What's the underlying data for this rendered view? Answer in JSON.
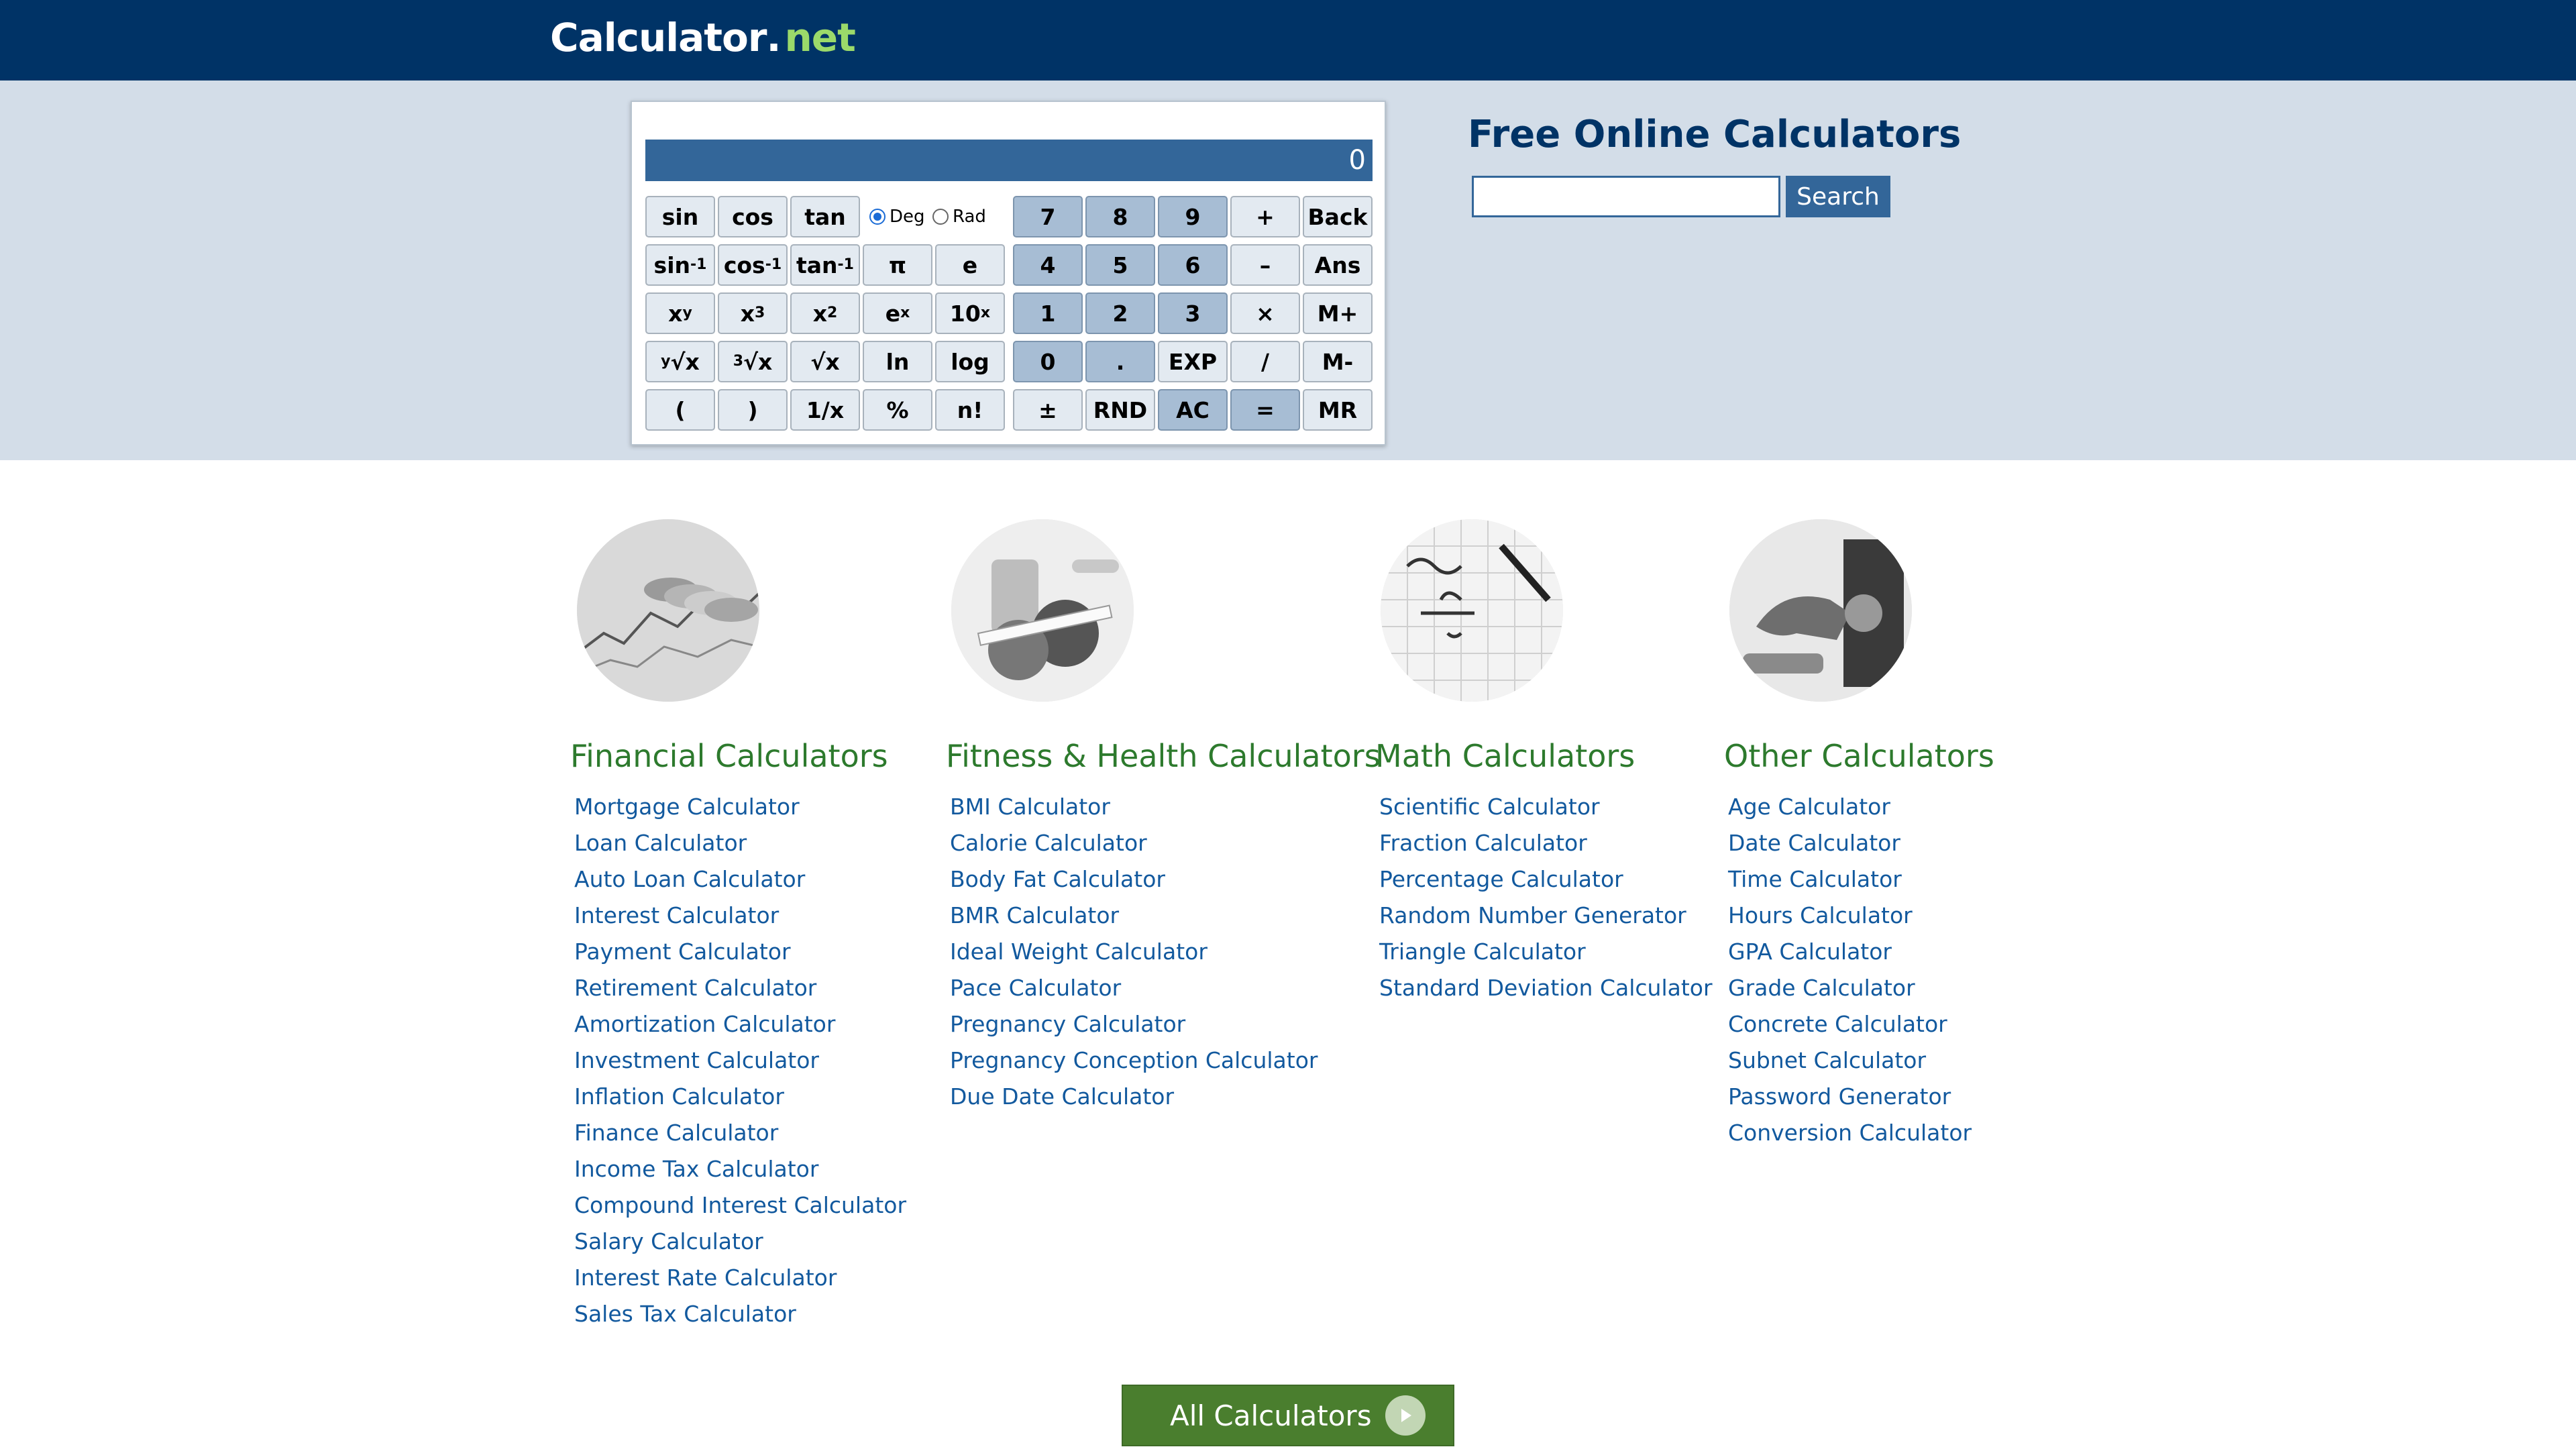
{
  "header": {
    "logo_part1": "Calculator",
    "logo_part2": ".",
    "logo_part3": "net"
  },
  "calculator": {
    "display_value": "0",
    "angle_mode": {
      "deg_label": "Deg",
      "rad_label": "Rad",
      "selected": "Deg"
    },
    "keys": {
      "sin": "sin",
      "cos": "cos",
      "tan": "tan",
      "asin": "sin",
      "acos": "cos",
      "atan": "tan",
      "inv": "-1",
      "pi": "π",
      "e": "e",
      "xy_base": "x",
      "xy_exp": "y",
      "x3_base": "x",
      "x3_exp": "3",
      "x2_base": "x",
      "x2_exp": "2",
      "ex_base": "e",
      "ex_exp": "x",
      "tenx_base": "10",
      "tenx_exp": "x",
      "yroot_pre": "y",
      "yroot": "√x",
      "croot_pre": "3",
      "croot": "√x",
      "sqrt": "√x",
      "ln": "ln",
      "log": "log",
      "lparen": "(",
      "rparen": ")",
      "recip": "1/x",
      "percent": "%",
      "fact": "n!",
      "n7": "7",
      "n8": "8",
      "n9": "9",
      "n4": "4",
      "n5": "5",
      "n6": "6",
      "n1": "1",
      "n2": "2",
      "n3": "3",
      "n0": "0",
      "dot": ".",
      "plus": "+",
      "minus": "–",
      "times": "×",
      "divide": "/",
      "back": "Back",
      "ans": "Ans",
      "mplus": "M+",
      "mminus": "M-",
      "mr": "MR",
      "exp": "EXP",
      "plusminus": "±",
      "rnd": "RND",
      "ac": "AC",
      "equals": "="
    }
  },
  "search": {
    "title": "Free Online Calculators",
    "button_label": "Search",
    "value": ""
  },
  "categories": [
    {
      "title": "Financial Calculators",
      "items": [
        "Mortgage Calculator",
        "Loan Calculator",
        "Auto Loan Calculator",
        "Interest Calculator",
        "Payment Calculator",
        "Retirement Calculator",
        "Amortization Calculator",
        "Investment Calculator",
        "Inflation Calculator",
        "Finance Calculator",
        "Income Tax Calculator",
        "Compound Interest Calculator",
        "Salary Calculator",
        "Interest Rate Calculator",
        "Sales Tax Calculator"
      ]
    },
    {
      "title": "Fitness & Health Calculators",
      "items": [
        "BMI Calculator",
        "Calorie Calculator",
        "Body Fat Calculator",
        "BMR Calculator",
        "Ideal Weight Calculator",
        "Pace Calculator",
        "Pregnancy Calculator",
        "Pregnancy Conception Calculator",
        "Due Date Calculator"
      ]
    },
    {
      "title": "Math Calculators",
      "items": [
        "Scientific Calculator",
        "Fraction Calculator",
        "Percentage Calculator",
        "Random Number Generator",
        "Triangle Calculator",
        "Standard Deviation Calculator"
      ]
    },
    {
      "title": "Other Calculators",
      "items": [
        "Age Calculator",
        "Date Calculator",
        "Time Calculator",
        "Hours Calculator",
        "GPA Calculator",
        "Grade Calculator",
        "Concrete Calculator",
        "Subnet Calculator",
        "Password Generator",
        "Conversion Calculator"
      ]
    }
  ],
  "all_calculators_label": "All Calculators",
  "colors": {
    "header": "#003366",
    "band": "#d3dde8",
    "accent": "#336699",
    "category_title": "#2d7a2d",
    "link": "#12599e",
    "button_green": "#4a7e2e"
  }
}
